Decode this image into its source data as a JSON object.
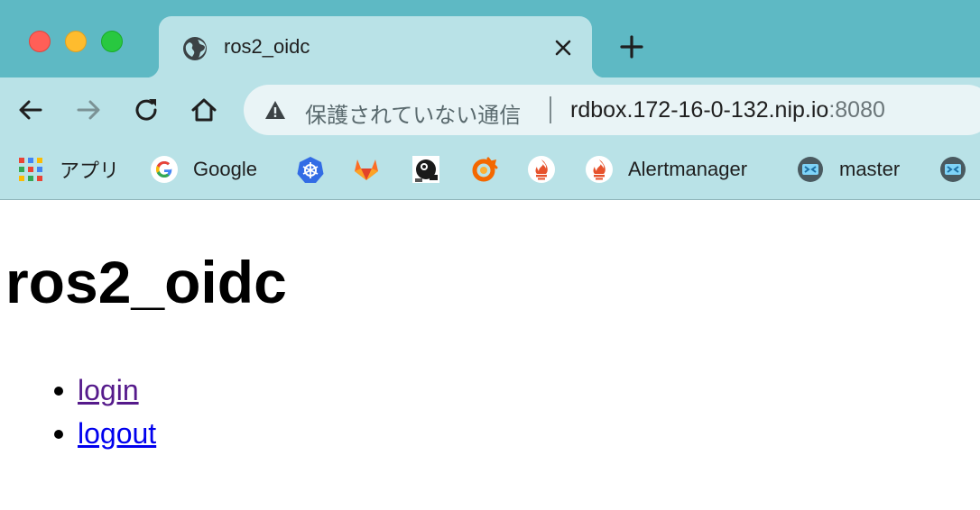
{
  "tab": {
    "title": "ros2_oidc",
    "favicon": "globe-icon"
  },
  "toolbar": {
    "back": "arrow-left-icon",
    "forward": "arrow-right-icon",
    "reload": "reload-icon",
    "home": "home-icon"
  },
  "omnibox": {
    "security_status": "保護されていない通信",
    "url_host": "rdbox.172-16-0-132.nip.io",
    "url_port": ":8080"
  },
  "bookmarks": [
    {
      "label": "アプリ",
      "icon": "apps-grid-icon"
    },
    {
      "label": "Google",
      "icon": "google-icon"
    },
    {
      "label": "",
      "icon": "kubernetes-icon"
    },
    {
      "label": "",
      "icon": "gitlab-icon"
    },
    {
      "label": "",
      "icon": "robot-icon"
    },
    {
      "label": "",
      "icon": "grafana-icon"
    },
    {
      "label": "",
      "icon": "prometheus-icon"
    },
    {
      "label": "Alertmanager",
      "icon": "prometheus-icon"
    },
    {
      "label": "master",
      "icon": "jenkins-icon"
    },
    {
      "label": "",
      "icon": "jenkins-icon"
    }
  ],
  "page": {
    "title": "ros2_oidc",
    "links": [
      {
        "label": "login",
        "visited": true
      },
      {
        "label": "logout",
        "visited": false
      }
    ]
  },
  "colors": {
    "tabbar": "#5eb9c4",
    "toolbar": "#b9e2e7",
    "link_visited": "#551a8b",
    "link_default": "#0000ee"
  }
}
